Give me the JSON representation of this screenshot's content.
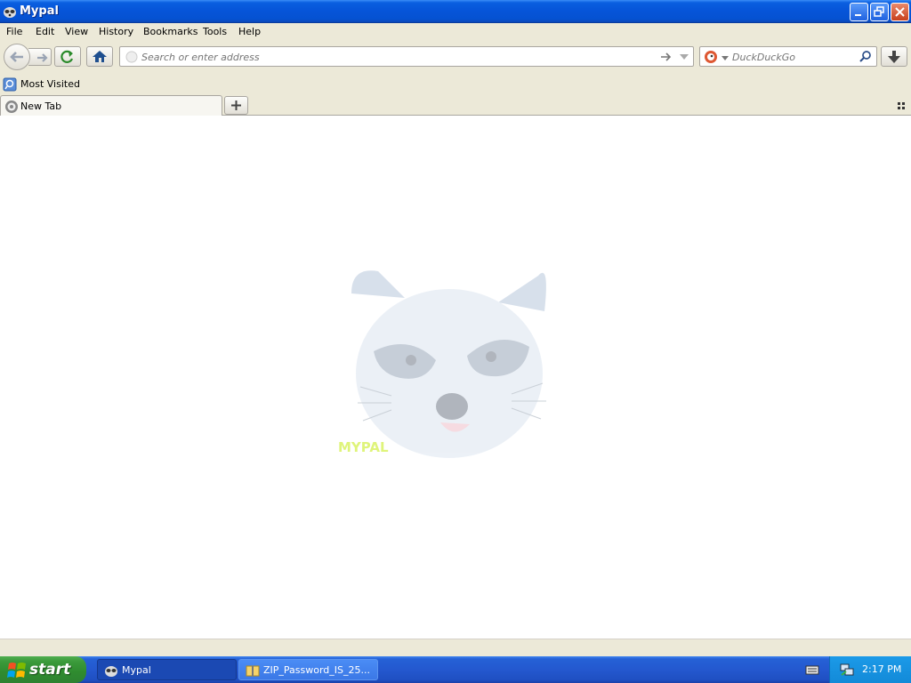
{
  "window": {
    "title": "Mypal"
  },
  "menu": [
    "File",
    "Edit",
    "View",
    "History",
    "Bookmarks",
    "Tools",
    "Help"
  ],
  "urlbar": {
    "placeholder": "Search or enter address"
  },
  "search": {
    "placeholder": "DuckDuckGo"
  },
  "bookmarks": {
    "most_visited": "Most Visited"
  },
  "tabs": [
    {
      "label": "New Tab"
    }
  ],
  "taskbar": {
    "start": "start",
    "tasks": [
      {
        "label": "Mypal"
      },
      {
        "label": "ZIP_Password_IS_25..."
      }
    ],
    "clock": "2:17 PM"
  }
}
